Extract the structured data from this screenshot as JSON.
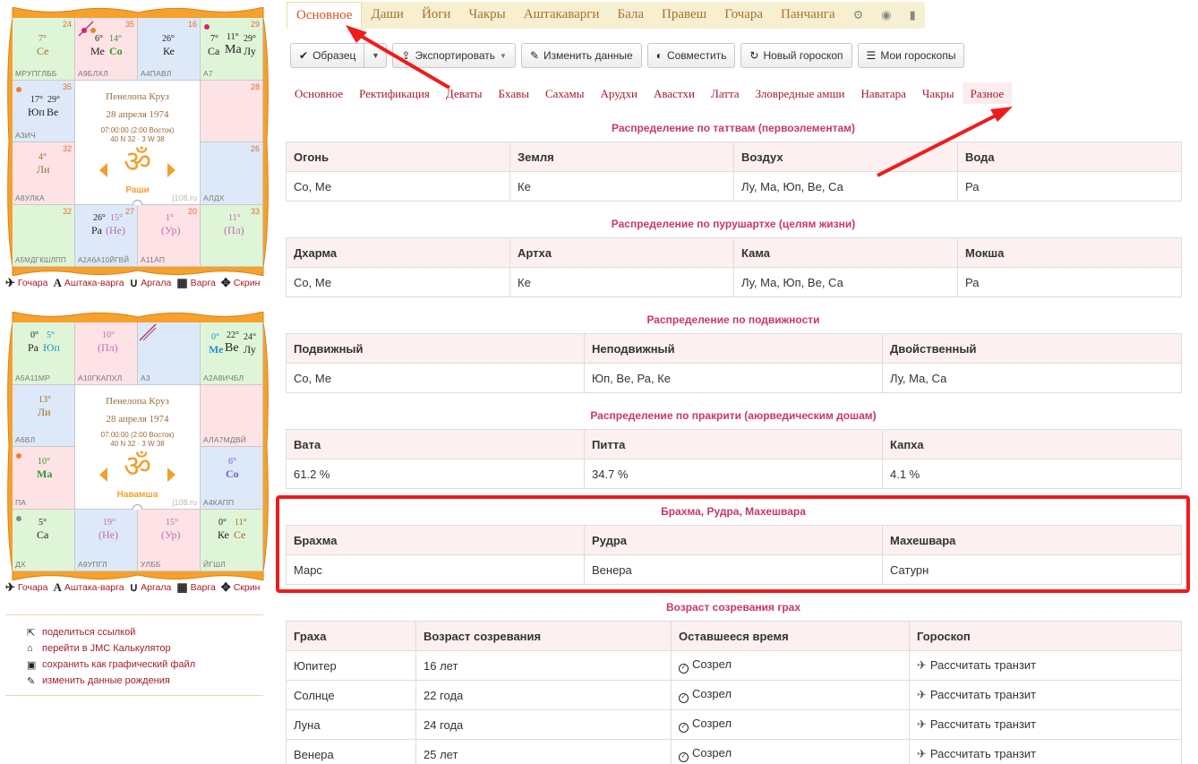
{
  "rasi_chart": {
    "name": "Пенелопа Круз",
    "date": "28 апреля 1974",
    "time": "07:00:00 (2:00 Восток)",
    "coords": "40 N 32 · 3 W 38",
    "om": "ॐ",
    "kind": "Раши",
    "site": "j108.ru",
    "cells": {
      "c00": {
        "num": "24",
        "deg": "7°",
        "planet": "Се",
        "label": "МРУПГЛББ"
      },
      "c01": {
        "num": "35",
        "deg1": "6°",
        "pl1": "Ме",
        "deg2": "14°",
        "pl2": "Со",
        "label": "А9БЛХЛ"
      },
      "c02": {
        "num": "16",
        "deg": "26°",
        "planet": "Ке",
        "label": "А4ПАВЛ"
      },
      "c03": {
        "num": "29",
        "deg1": "7°",
        "pl1": "Са",
        "deg2": "11°",
        "pl2": "Ма",
        "deg3": "29°",
        "pl3": "Лу",
        "label": "А7"
      },
      "c10": {
        "num": "35",
        "deg1": "17°",
        "pl1": "Юп",
        "deg2": "29°",
        "pl2": "Ве",
        "label": "А3ИЧ"
      },
      "c13": {
        "num": "28",
        "label": ""
      },
      "c20": {
        "num": "32",
        "deg": "4°",
        "planet": "Ли",
        "label": "А8УЛКА"
      },
      "c23": {
        "num": "26",
        "label": "АЛДХ"
      },
      "c30": {
        "num": "32",
        "label": "А5МДГКШЛПП"
      },
      "c31": {
        "num": "27",
        "deg1": "26°",
        "pl1": "Ра",
        "deg2": "15°",
        "pl2": "(Не)",
        "label": "А2А6А10ЙГВЙ"
      },
      "c32": {
        "num": "20",
        "deg": "1°",
        "planet": "(Ур)",
        "label": "А11АП"
      },
      "c33": {
        "num": "33",
        "deg": "11°",
        "planet": "(Пл)",
        "label": ""
      }
    }
  },
  "navamsa_chart": {
    "name": "Пенелопа Круз",
    "date": "28 апреля 1974",
    "time": "07:00:00 (2:00 Восток)",
    "coords": "40 N 32 · 3 W 38",
    "om": "ॐ",
    "kind": "Навамша",
    "site": "j108.ru",
    "cells": {
      "c00": {
        "deg1": "0°",
        "pl1": "Ра",
        "deg2": "5°",
        "pl2": "Юп",
        "label": "А5А11МР"
      },
      "c01": {
        "deg": "10°",
        "planet": "(Пл)",
        "label": "А10ГКАПХЛ"
      },
      "c02": {
        "label": "А3"
      },
      "c03": {
        "deg1": "0°",
        "pl1": "Ме",
        "deg2": "22°",
        "pl2": "Ве",
        "deg3": "24°",
        "pl3": "Лу",
        "label": "А2А8ИЧБЛ"
      },
      "c10": {
        "deg": "13°",
        "planet": "Ли",
        "label": "А6ВЛ"
      },
      "c13": {
        "label": "АЛА7МДВЙ"
      },
      "c20": {
        "deg": "10°",
        "planet": "Ма",
        "label": "ПА"
      },
      "c23": {
        "deg": "6°",
        "planet": "Со",
        "label": "А4КАПП"
      },
      "c30": {
        "deg": "5°",
        "planet": "Са",
        "label": "ДХ"
      },
      "c31": {
        "deg": "19°",
        "planet": "(Не)",
        "label": "А9УПГЛ"
      },
      "c32": {
        "deg": "15°",
        "planet": "(Ур)",
        "label": "УЛББ"
      },
      "c33": {
        "deg1": "0°",
        "pl1": "Ке",
        "deg2": "11°",
        "pl2": "Се",
        "label": "ЙГШЛ"
      }
    }
  },
  "chart_links": {
    "gochara": "Гочара",
    "ashtaka": "Аштака-варга",
    "argala": "Аргала",
    "varga": "Варга",
    "screen": "Скрин"
  },
  "side_links": {
    "share": "поделиться ссылкой",
    "jmc": "перейти в JMC Калькулятор",
    "save_image": "сохранить как графический файл",
    "edit_birth": "изменить данные рождения"
  },
  "tabs": [
    "Основное",
    "Даши",
    "Йоги",
    "Чакры",
    "Аштакаварги",
    "Бала",
    "Правеш",
    "Гочара",
    "Панчанга"
  ],
  "tab_icons": [
    "gear-icon",
    "globe-icon",
    "book-icon"
  ],
  "toolbar": {
    "sample": "Образец",
    "export": "Экспортировать",
    "edit": "Изменить данные",
    "combine": "Совместить",
    "new": "Новый гороскоп",
    "my": "Мои гороскопы"
  },
  "subtabs": [
    "Основное",
    "Ректификация",
    "Деваты",
    "Бхавы",
    "Сахамы",
    "Арудхи",
    "Авастхи",
    "Латта",
    "Зловредные амши",
    "Наватара",
    "Чакры",
    "Разное"
  ],
  "tattva": {
    "title": "Распределение по таттвам (первоэлементам)",
    "headers": [
      "Огонь",
      "Земля",
      "Воздух",
      "Вода"
    ],
    "row": [
      "Со, Ме",
      "Ке",
      "Лу, Ма, Юп, Ве, Са",
      "Ра"
    ]
  },
  "purushartha": {
    "title": "Распределение по пурушартхе (целям жизни)",
    "headers": [
      "Дхарма",
      "Артха",
      "Кама",
      "Мокша"
    ],
    "row": [
      "Со, Ме",
      "Ке",
      "Лу, Ма, Юп, Ве, Са",
      "Ра"
    ]
  },
  "mobility": {
    "title": "Распределение по подвижности",
    "headers": [
      "Подвижный",
      "Неподвижный",
      "Двойственный"
    ],
    "row": [
      "Со, Ме",
      "Юп, Ве, Ра, Ке",
      "Лу, Ма, Са"
    ]
  },
  "prakriti": {
    "title": "Распределение по пракрити (аюрведическим дошам)",
    "headers": [
      "Вата",
      "Питта",
      "Капха"
    ],
    "row": [
      "61.2 %",
      "34.7 %",
      "4.1 %"
    ]
  },
  "trimurti": {
    "title": "Брахма, Рудра, Махешвара",
    "headers": [
      "Брахма",
      "Рудра",
      "Махешвара"
    ],
    "row": [
      "Марс",
      "Венера",
      "Сатурн"
    ]
  },
  "maturity": {
    "title": "Возраст созревания грах",
    "headers": [
      "Граха",
      "Возраст созревания",
      "Оставшееся время",
      "Гороскоп"
    ],
    "rows": [
      [
        "Юпитер",
        "16 лет",
        "Созрел",
        "Рассчитать транзит"
      ],
      [
        "Солнце",
        "22 года",
        "Созрел",
        "Рассчитать транзит"
      ],
      [
        "Луна",
        "24 года",
        "Созрел",
        "Рассчитать транзит"
      ],
      [
        "Венера",
        "25 лет",
        "Созрел",
        "Рассчитать транзит"
      ]
    ]
  },
  "colors": {
    "accent": "#d9531e",
    "link": "#a11c2a",
    "section_title": "#c8366d",
    "highlight": "#ee1c1c"
  }
}
